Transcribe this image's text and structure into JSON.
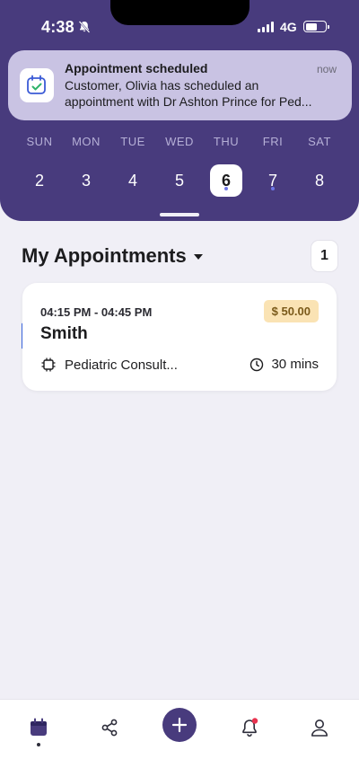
{
  "status_bar": {
    "time": "4:38",
    "network": "4G"
  },
  "notification": {
    "title": "Appointment scheduled",
    "time": "now",
    "body_line1": "Customer, Olivia has scheduled an",
    "body_line2": "appointment with Dr Ashton Prince for Ped..."
  },
  "week": {
    "days": [
      {
        "name": "SUN",
        "num": "2"
      },
      {
        "name": "MON",
        "num": "3"
      },
      {
        "name": "TUE",
        "num": "4"
      },
      {
        "name": "WED",
        "num": "5"
      },
      {
        "name": "THU",
        "num": "6"
      },
      {
        "name": "FRI",
        "num": "7"
      },
      {
        "name": "SAT",
        "num": "8"
      }
    ],
    "selected_day": "6",
    "days_with_events": [
      "6",
      "7"
    ]
  },
  "appointments": {
    "title": "My Appointments",
    "count": "1",
    "items": [
      {
        "time_range": "04:15 PM - 04:45 PM",
        "price": "$ 50.00",
        "client": "Smith",
        "service": "Pediatric Consult...",
        "duration": "30 mins"
      }
    ]
  },
  "colors": {
    "header": "#483b7d",
    "accent_blue": "#3b67e0",
    "price_badge": "#fae3b4",
    "notification_badge": "#e8334f"
  },
  "icons": {
    "nav": [
      "calendar-icon",
      "share-icon",
      "plus-icon",
      "bell-icon",
      "profile-icon"
    ]
  }
}
